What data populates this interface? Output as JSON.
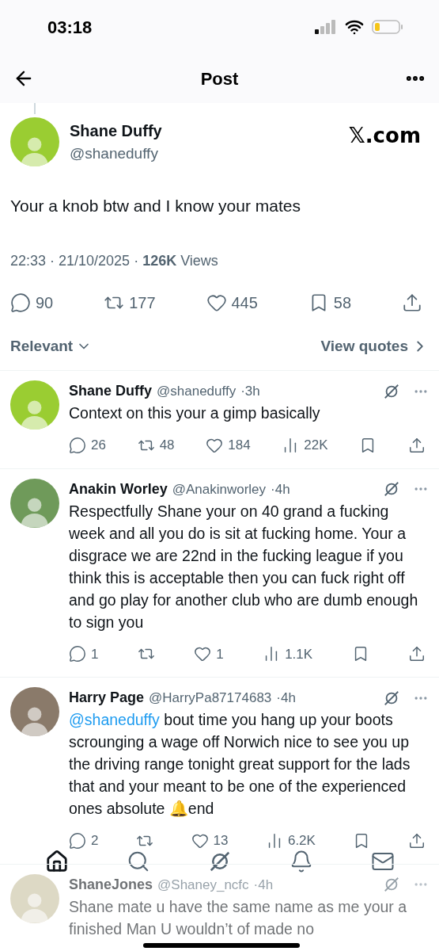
{
  "status_bar": {
    "time": "03:18"
  },
  "header": {
    "title": "Post"
  },
  "post": {
    "name": "Shane Duffy",
    "handle": "@shaneduffy",
    "watermark": "𝕏.com",
    "text": "Your a knob btw and I know your mates",
    "meta": "22:33 · 21/10/2025 · **126K** Views",
    "actions": [
      {
        "kind": "reply",
        "count": "90"
      },
      {
        "kind": "repost",
        "count": "177"
      },
      {
        "kind": "like",
        "count": "445"
      },
      {
        "kind": "bookmark",
        "count": "58"
      },
      {
        "kind": "share"
      }
    ]
  },
  "sort": {
    "label": "Relevant",
    "quotes_link": "View quotes"
  },
  "replies": [
    {
      "name": "Shane Duffy",
      "handle": "@shaneduffy",
      "age": "·3h",
      "text": "Context on this your a gimp basically",
      "faded": false,
      "actions": [
        {
          "kind": "reply",
          "count": "26"
        },
        {
          "kind": "repost",
          "count": "48"
        },
        {
          "kind": "like",
          "count": "184"
        },
        {
          "kind": "views",
          "count": "22K"
        },
        {
          "kind": "bookmark"
        },
        {
          "kind": "share"
        }
      ]
    },
    {
      "name": "Anakin Worley",
      "handle": "@Anakinworley",
      "age": "·4h",
      "text": "Respectfully Shane your on 40 grand a fucking week and all you do is sit at fucking home. Your a disgrace we are 22nd in the fucking league if you think this is acceptable then you can fuck right off and go play for another club who are dumb enough to sign you",
      "faded": false,
      "actions": [
        {
          "kind": "reply",
          "count": "1"
        },
        {
          "kind": "repost"
        },
        {
          "kind": "like",
          "count": "1"
        },
        {
          "kind": "views",
          "count": "1.1K"
        },
        {
          "kind": "bookmark"
        },
        {
          "kind": "share"
        }
      ]
    },
    {
      "name": "Harry Page",
      "handle": "@HarryPa87174683",
      "age": "·4h",
      "mention": "@shaneduffy",
      "text": "bout time you hang up your boots scrounging a wage off Norwich nice to see you up the driving range tonight great support for the lads that and your meant to be one of the experienced ones absolute 🔔end",
      "faded": false,
      "actions": [
        {
          "kind": "reply",
          "count": "2"
        },
        {
          "kind": "repost"
        },
        {
          "kind": "like",
          "count": "13"
        },
        {
          "kind": "views",
          "count": "6.2K"
        },
        {
          "kind": "bookmark"
        },
        {
          "kind": "share"
        }
      ]
    },
    {
      "name": "ShaneJones",
      "handle": "@Shaney_ncfc",
      "age": "·4h",
      "text": "Shane mate u have the same name as me your a finished Man U wouldn’t of made no",
      "faded": true
    }
  ],
  "tab_bar": [
    {
      "kind": "home",
      "selected": true
    },
    {
      "kind": "search",
      "selected": false
    },
    {
      "kind": "grok",
      "selected": false
    },
    {
      "kind": "notifications",
      "selected": false
    },
    {
      "kind": "messages",
      "selected": false
    }
  ]
}
